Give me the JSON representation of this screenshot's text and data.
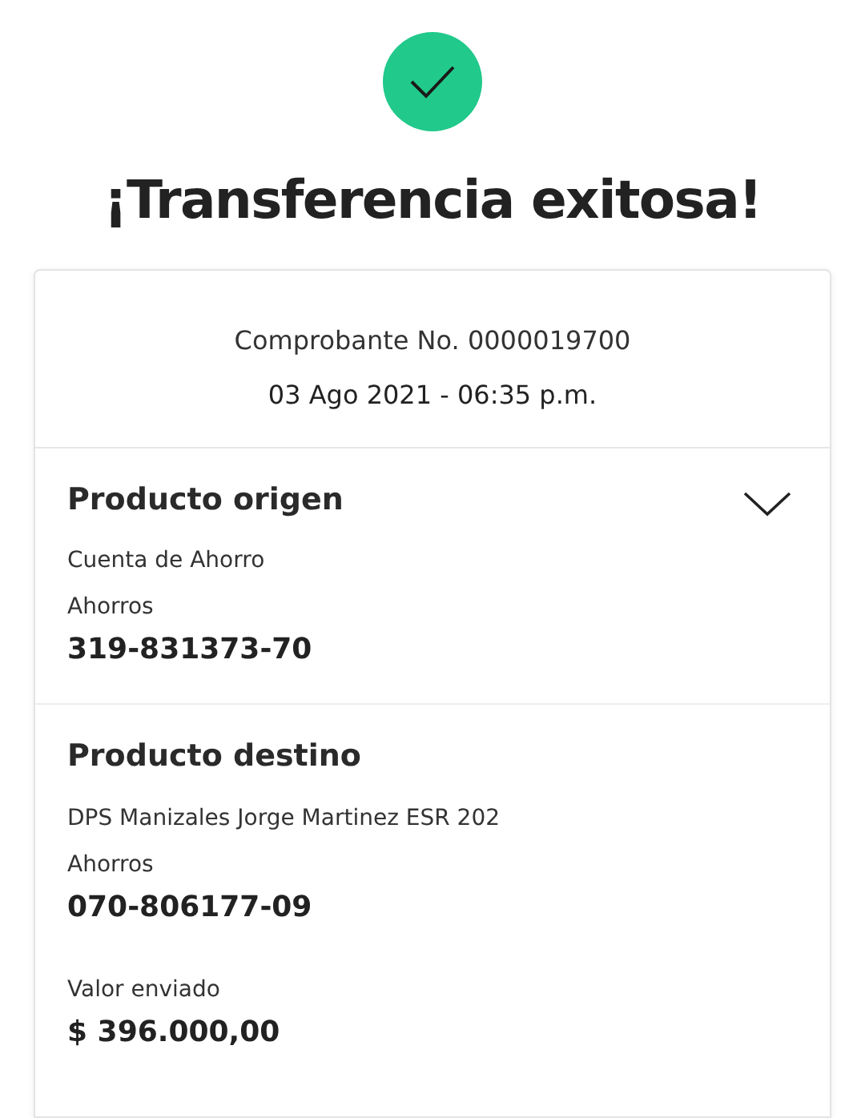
{
  "title": "¡Transferencia exitosa!",
  "receipt": {
    "number": "Comprobante No. 0000019700",
    "date": "03 Ago 2021 - 06:35 p.m."
  },
  "sections": [
    {
      "heading": "Producto origen",
      "collapsible": true,
      "lines": [
        {
          "kind": "label",
          "text": "Cuenta de Ahorro"
        },
        {
          "kind": "label",
          "text": "Ahorros"
        },
        {
          "kind": "value",
          "text": "319-831373-70"
        }
      ]
    },
    {
      "heading": "Producto destino",
      "collapsible": false,
      "lines": [
        {
          "kind": "label",
          "text": "DPS Manizales Jorge Martinez ESR 202"
        },
        {
          "kind": "label",
          "text": "Ahorros"
        },
        {
          "kind": "value",
          "text": "070-806177-09"
        },
        {
          "kind": "label",
          "text": "Valor enviado"
        },
        {
          "kind": "value",
          "text": "$ 396.000,00"
        }
      ]
    }
  ]
}
